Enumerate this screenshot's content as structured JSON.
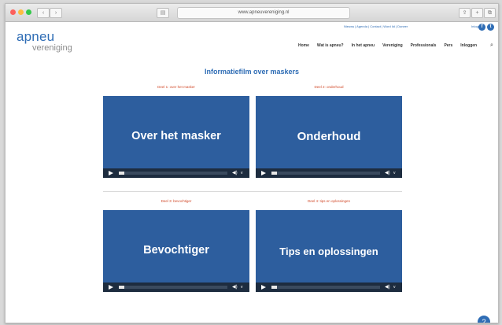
{
  "browser": {
    "url": "www.apneuvereniging.nl",
    "colors": {
      "chrome": "#e0e0e0"
    },
    "icons": {
      "back": "chevron-left-icon",
      "forward": "chevron-right-icon",
      "sidebar": "sidebar-icon",
      "share": "share-icon",
      "reader": "reader-icon",
      "tabs": "tabs-icon"
    },
    "symbols": {
      "back": "‹",
      "forward": "›",
      "sidebar": "▤",
      "share": "⇪",
      "new_tab": "+",
      "tabs": "⧉"
    }
  },
  "site": {
    "logo": {
      "top": "apneu",
      "bottom": "vereniging"
    },
    "topbar": {
      "text": "Nieuws | Agenda | Contact | Word lid | Doneer",
      "login": "Inloggen"
    },
    "social": [
      {
        "name": "facebook-icon",
        "glyph": "f"
      },
      {
        "name": "twitter-icon",
        "glyph": "t"
      }
    ],
    "nav": [
      "Home",
      "Wat is apneu?",
      "In het apneu",
      "Vereniging",
      "Professionals",
      "Pers",
      "Inloggen"
    ],
    "search_icon": "⌕",
    "brand_color": "#2f6db5"
  },
  "page": {
    "title": "Informatiefilm over maskers",
    "videos": [
      {
        "section": "Deel 1: over het masker",
        "title": "Over het masker",
        "progress": 0.05,
        "volume_glyph": "◀)",
        "logo_glyph": "v"
      },
      {
        "section": "Deel 2: onderhoud",
        "title": "Onderhoud",
        "progress": 0.05,
        "volume_glyph": "◀)",
        "logo_glyph": "v"
      },
      {
        "section": "Deel 3: bevochtiger",
        "title": "Bevochtiger",
        "progress": 0.05,
        "volume_glyph": "◀)",
        "logo_glyph": "v"
      },
      {
        "section": "Deel 4: tips en oplossingen",
        "title": "Tips en oplossingen",
        "progress": 0.05,
        "volume_glyph": "◀)",
        "logo_glyph": "v"
      }
    ],
    "video_bg": "#2d5e9e",
    "accent": "#d14a2a"
  },
  "help": {
    "glyph": "?"
  }
}
